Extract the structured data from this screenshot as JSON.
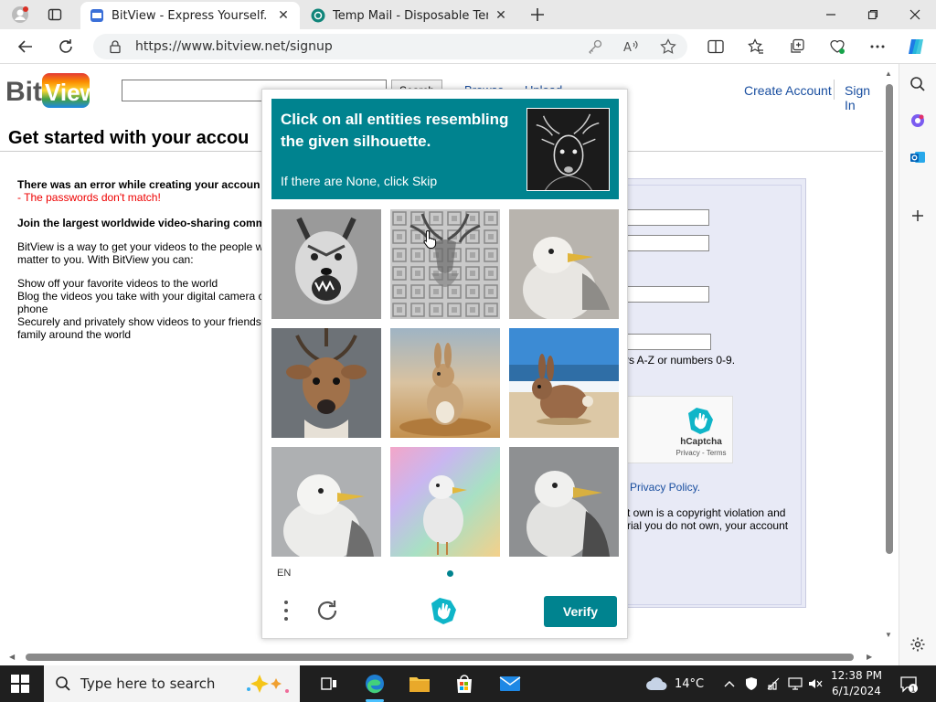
{
  "browser": {
    "tabs": [
      {
        "title": "BitView - Express Yourself.",
        "active": true
      },
      {
        "title": "Temp Mail - Disposable Tempora",
        "active": false
      }
    ],
    "url": "https://www.bitview.net/signup"
  },
  "site": {
    "logo_text": "BitView",
    "search_button": "Search",
    "nav": {
      "browse": "Browse",
      "upload": "Upload",
      "create_account": "Create Account",
      "sign_in": "Sign In"
    },
    "page_title": "Get started with your accou",
    "error_heading": "There was an error while creating your accoun",
    "error_detail": "- The passwords don't match!",
    "join_heading": "Join the largest worldwide video-sharing comm",
    "intro_line1": "BitView is a way to get your videos to the people w",
    "intro_line2": "matter to you. With BitView you can:",
    "bullet1": "Show off your favorite videos to the world",
    "bullet2a": "Blog the videos you take with your digital camera c",
    "bullet2b": "phone",
    "bullet3a": "Securely and privately show videos to your friends",
    "bullet3b": "family around the world",
    "form_hint": "rs A-Z or numbers 0-9.",
    "privacy_link": "Privacy Policy.",
    "copyright1": "t own is a copyright violation and",
    "copyright2": "rial you do not own, your account",
    "hcaptcha_widget": {
      "name": "hCaptcha",
      "terms": "Privacy - Terms"
    }
  },
  "challenge": {
    "prompt": "Click on all entities resembling the given silhouette.",
    "sub": "If there are None, click Skip",
    "tiles": [
      "wolf",
      "deer-silhouette-pattern",
      "seagull",
      "deer",
      "rabbit-on-sand",
      "rabbit-on-beach",
      "seagull",
      "seagull-rainbow",
      "seagull"
    ],
    "language": "EN",
    "verify_label": "Verify",
    "accent": "#00838f"
  },
  "taskbar": {
    "search_placeholder": "Type here to search",
    "weather": "14°C",
    "time": "12:38 PM",
    "date": "6/1/2024",
    "notifications": "1"
  }
}
